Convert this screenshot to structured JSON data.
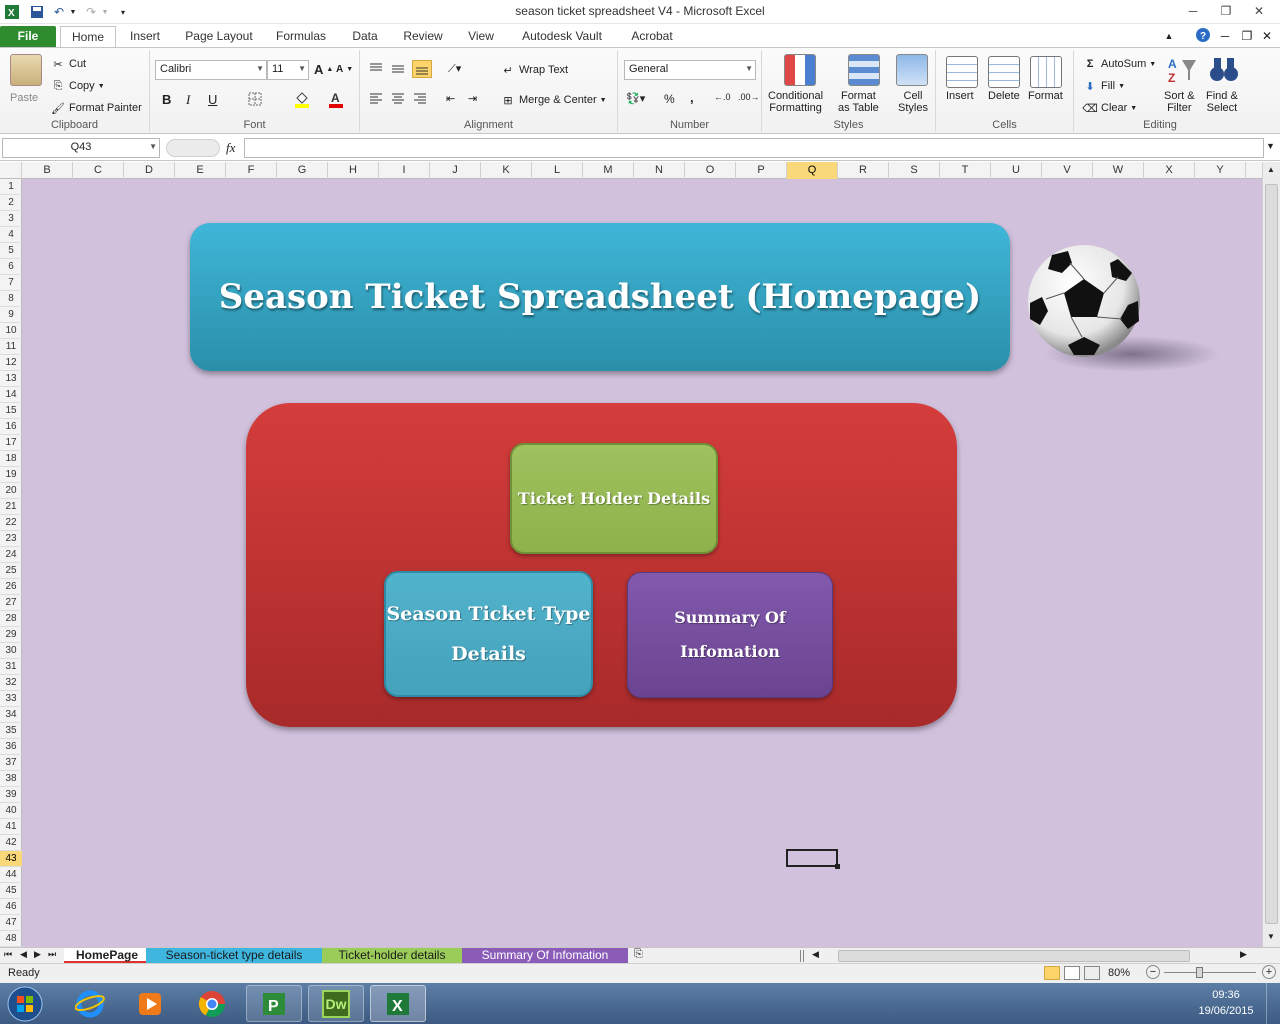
{
  "window": {
    "title": "season ticket spreadsheet V4  -  Microsoft Excel",
    "minimize": "─",
    "maximize": "❐",
    "close": "✕"
  },
  "ribbon_tabs": [
    "File",
    "Home",
    "Insert",
    "Page Layout",
    "Formulas",
    "Data",
    "Review",
    "View",
    "Autodesk Vault",
    "Acrobat"
  ],
  "clipboard": {
    "paste": "Paste",
    "cut": "Cut",
    "copy": "Copy",
    "format_painter": "Format Painter",
    "label": "Clipboard"
  },
  "font": {
    "family": "Calibri",
    "size": "11",
    "bold": "B",
    "italic": "I",
    "underline": "U",
    "label": "Font"
  },
  "alignment": {
    "wrap_text": "Wrap Text",
    "merge_center": "Merge & Center",
    "label": "Alignment"
  },
  "number": {
    "format": "General",
    "percent": "%",
    "comma": ",",
    "label": "Number"
  },
  "styles": {
    "conditional_1": "Conditional",
    "conditional_2": "Formatting",
    "format_table_1": "Format",
    "format_table_2": "as Table",
    "cell_styles_1": "Cell",
    "cell_styles_2": "Styles",
    "label": "Styles"
  },
  "cells": {
    "insert": "Insert",
    "delete": "Delete",
    "format": "Format",
    "label": "Cells"
  },
  "editing": {
    "autosum": "AutoSum",
    "fill": "Fill",
    "clear": "Clear",
    "sort_1": "Sort &",
    "sort_2": "Filter",
    "find_1": "Find &",
    "find_2": "Select",
    "label": "Editing"
  },
  "formula_bar": {
    "name_box": "Q43",
    "fx": "fx",
    "formula": ""
  },
  "columns": [
    "B",
    "C",
    "D",
    "E",
    "F",
    "G",
    "H",
    "I",
    "J",
    "K",
    "L",
    "M",
    "N",
    "O",
    "P",
    "Q",
    "R",
    "S",
    "T",
    "U",
    "V",
    "W",
    "X",
    "Y"
  ],
  "selected_column": "Q",
  "rows": [
    "1",
    "2",
    "3",
    "4",
    "5",
    "6",
    "7",
    "8",
    "9",
    "10",
    "11",
    "12",
    "13",
    "14",
    "15",
    "16",
    "17",
    "18",
    "19",
    "20",
    "21",
    "22",
    "23",
    "24",
    "25",
    "26",
    "27",
    "28",
    "29",
    "30",
    "31",
    "32",
    "33",
    "34",
    "35",
    "36",
    "37",
    "38",
    "39",
    "40",
    "41",
    "42",
    "43",
    "44",
    "45",
    "46",
    "47",
    "48"
  ],
  "selected_row": "43",
  "sheet": {
    "banner_title": "Season Ticket Spreadsheet (Homepage)",
    "btn_ticket_holder": "Ticket Holder Details",
    "btn_season_type_1": "Season Ticket Type",
    "btn_season_type_2": "Details",
    "btn_summary_1": "Summary Of",
    "btn_summary_2": "Infomation",
    "colors": {
      "background": "#d1c1dd",
      "banner": "#33a7c8",
      "red_panel": "#c23534",
      "green_button": "#9bbb59",
      "blue_button": "#4bacc6",
      "purple_button": "#7b529b"
    }
  },
  "sheet_tabs": [
    {
      "label": "HomePage",
      "active": true,
      "color": "#e03030"
    },
    {
      "label": "Season-ticket type details",
      "active": false,
      "color": "#3fb6e0"
    },
    {
      "label": "Ticket-holder details",
      "active": false,
      "color": "#9bcc5a"
    },
    {
      "label": "Summary Of Infomation",
      "active": false,
      "color": "#8a5cb8"
    }
  ],
  "status": {
    "ready": "Ready",
    "zoom": "80%",
    "zoom_minus": "−",
    "zoom_plus": "+"
  },
  "taskbar": {
    "time": "09:36",
    "date": "19/06/2015",
    "dw_label": "Dw",
    "apps": [
      "start-orb",
      "internet-explorer",
      "media-player",
      "chrome",
      "project",
      "dreamweaver",
      "excel"
    ]
  }
}
